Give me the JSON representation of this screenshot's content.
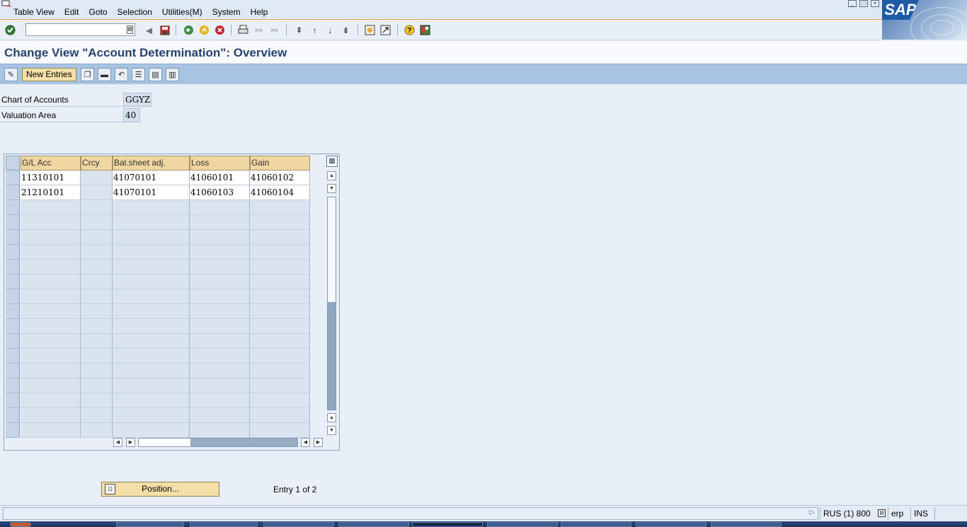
{
  "menubar": {
    "items": [
      "Table View",
      "Edit",
      "Goto",
      "Selection",
      "Utilities(M)",
      "System",
      "Help"
    ]
  },
  "systoolbar": {
    "command_value": ""
  },
  "title": "Change View \"Account Determination\": Overview",
  "apptoolbar": {
    "new_entries_label": "New Entries"
  },
  "fields": {
    "chart_of_accounts": {
      "label": "Chart of Accounts",
      "value": "GGYZ"
    },
    "valuation_area": {
      "label": "Valuation Area",
      "value": "40"
    }
  },
  "table": {
    "columns": [
      "G/L Acc",
      "Crcy",
      "Bal.sheet adj.",
      "Loss",
      "Gain"
    ],
    "rows": [
      [
        "11310101",
        "",
        "41070101",
        "41060101",
        "41060102"
      ],
      [
        "21210101",
        "",
        "41070101",
        "41060103",
        "41060104"
      ]
    ],
    "empty_row_count": 16
  },
  "position_button_label": "Position...",
  "entry_info": "Entry 1 of 2",
  "statusbar": {
    "system": "RUS (1) 800",
    "server": "erp",
    "mode": "INS"
  },
  "colors": {
    "title": "#27446f",
    "app_toolbar": "#a9c4e2",
    "header_cell": "#f0d7a1",
    "button": "#f3dfa8"
  }
}
